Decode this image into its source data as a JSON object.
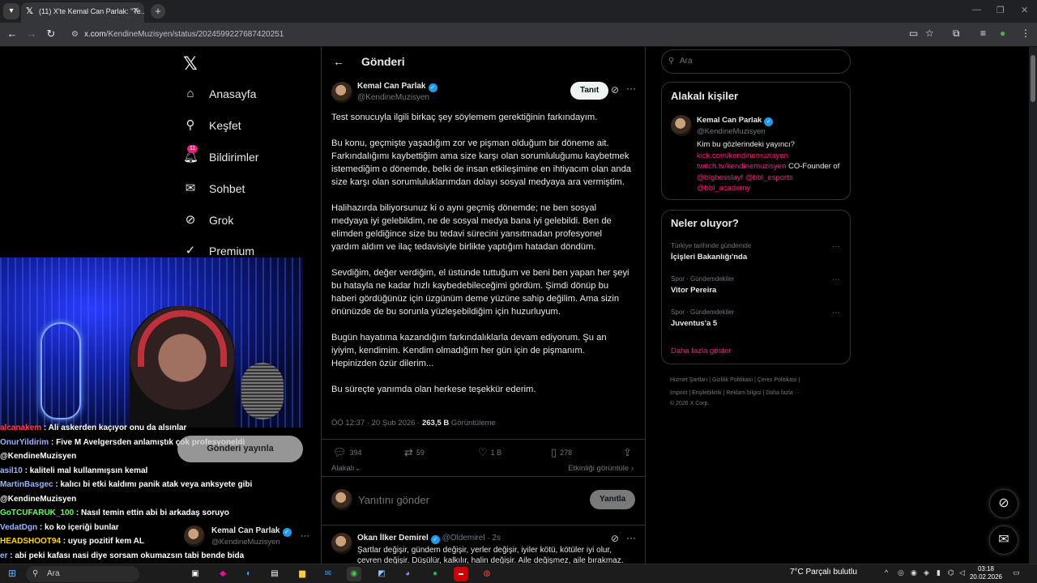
{
  "browser": {
    "tab_title": "(11) X'te Kemal Can Parlak: \"Te...",
    "tab_close": "✕",
    "url_host": "x.com",
    "url_path": "/KendineMuzisyen/status/2024599227687420251"
  },
  "nav": {
    "items": [
      {
        "label": "Anasayfa",
        "icon": "home-icon"
      },
      {
        "label": "Keşfet",
        "icon": "search-icon"
      },
      {
        "label": "Bildirimler",
        "icon": "bell-icon",
        "badge": "11"
      },
      {
        "label": "Sohbet",
        "icon": "mail-icon"
      },
      {
        "label": "Grok",
        "icon": "grok-icon"
      },
      {
        "label": "Premium",
        "icon": "premium-icon"
      }
    ]
  },
  "post": {
    "header_title": "Gönderi",
    "author_name": "Kemal Can Parlak",
    "author_handle": "@KendineMuzisyen",
    "follow_label": "Tanıt",
    "paragraphs": [
      "Test sonucuyla ilgili birkaç şey söylemem gerektiğinin farkındayım.",
      "Bu konu, geçmişte yaşadığım zor ve pişman olduğum bir döneme ait. Farkındalığımı kaybettiğim ama size karşı olan sorumluluğumu kaybetmek istemediğim o dönemde, belki de insan etkileşimine en ihtiyacım olan anda size karşı olan sorumluluklarımdan dolayı sosyal medyaya ara vermiştim.",
      "Halihazırda biliyorsunuz ki o aynı geçmiş dönemde; ne ben sosyal medyaya iyi gelebildim, ne de sosyal medya bana iyi gelebildi. Ben de elimden geldiğince size bu tedavi sürecini yansıtmadan profesyonel yardım aldım ve ilaç tedavisiyle birlikte yaptığım hatadan döndüm.",
      "Sevdiğim, değer verdiğim, el üstünde tuttuğum ve beni ben yapan her şeyi bu hatayla ne kadar hızlı kaybedebileceğimi gördüm. Şimdi dönüp bu haberi gördüğünüz için üzgünüm deme yüzüne sahip değilim. Ama sizin önünüzde de bu sorunla yüzleşebildiğim için huzurluyum.",
      "Bugün hayatıma kazandığım farkındalıklarla devam ediyorum. Şu an iyiyim, kendimim. Kendim olmadığım her gün için de pişmanım. Hepinizden özür dilerim...",
      "Bu süreçte yanımda olan herkese teşekkür ederim."
    ],
    "time": "ÖÖ 12:37 · 20 Şub 2026 · ",
    "views_count": "263,5 B",
    "views_label": " Görüntüleme",
    "replies": "394",
    "reposts": "59",
    "likes": "1 B",
    "bookmarks": "278",
    "relevance_label": "Alakalı",
    "activity_label": "Etkinliği görüntüle",
    "reply_placeholder": "Yanıtını gönder",
    "reply_button": "Yanıtla"
  },
  "reply_tweet": {
    "name": "Okan İlker Demirel",
    "handle": "@Oldemirel · 2s",
    "text": "Şartlar değişir, gündem değişir, yerler değişir, iyiler kötü, kötüler iyi olur, çevren değişir. Düşülür, kalkılır, halin değişir. Aile değişmez, aile bırakmaz."
  },
  "right": {
    "search_placeholder": "Ara",
    "related_title": "Alakalı kişiler",
    "related_name": "Kemal Can Parlak",
    "related_handle": "@KendineMuzisyen",
    "related_bio_1": "Kim bu gözlerindeki yayıncı?",
    "related_link_1": "kick.com/kendinemuzisyen",
    "related_link_2": "twitch.tv/kendinemuzisyen",
    "related_bio_2": " CO-Founder of ",
    "related_link_3": "@blgbosslayf",
    "related_link_4": "@bbl_esports",
    "related_link_5": "@bbl_academy",
    "trends_title": "Neler oluyor?",
    "trends": [
      {
        "category": "Türkiye tarihinde gündemde",
        "name": "İçişleri Bakanlığı'nda"
      },
      {
        "category": "Spor · Gündemdekiler",
        "name": "Vitor Pereira"
      },
      {
        "category": "Spor · Gündemdekiler",
        "name": "Juventus'a 5"
      }
    ],
    "show_more": "Daha fazla göster",
    "footer_line1": "Hizmet Şartları  |  Gizlilik Politikası  |  Çerez Politikası  |",
    "footer_line2": "Imprint  |  Erişilebilirlik  |  Reklam bilgisi  |  Daha fazla ···",
    "footer_line3": "© 2026 X Corp."
  },
  "stream": {
    "publish_button": "Gönderi yayınla",
    "overlay_name": "Kemal Can Parlak",
    "overlay_handle": "@KendineMuzisyen",
    "chat": [
      {
        "user": "alcanakem",
        "color": "#ff4040",
        "msg": " : Ali askerden kaçıyor onu da alsınlar"
      },
      {
        "user": "OnurYildirim",
        "color": "#9bb4ff",
        "msg": " : Five M Avelgersden anlamıştık çok profesyoneldi"
      },
      {
        "user": "",
        "color": "#ffffff",
        "msg": "@KendineMuzisyen"
      },
      {
        "user": "asil10",
        "color": "#9bb4ff",
        "msg": " : kaliteli mal kullanmışsın kemal"
      },
      {
        "user": "MartinBasgec",
        "color": "#9bb4ff",
        "msg": " : kalıcı bi etki kaldımı panik atak veya anksyete gibi"
      },
      {
        "user": "",
        "color": "#ffffff",
        "msg": "@KendineMuzisyen"
      },
      {
        "user": "GoTCUFARUK_100",
        "color": "#5cff5c",
        "msg": " : Nasıl temin ettin abi bi arkadaş soruyo"
      },
      {
        "user": "VedatDgn",
        "color": "#9bb4ff",
        "msg": " : ko ko içeriği bunlar"
      },
      {
        "user": "HEADSHOOT94",
        "color": "#ffd700",
        "msg": " : uyuş pozitif kem AL"
      },
      {
        "user": "er",
        "color": "#9bb4ff",
        "msg": " : abi peki kafası nasi diye sorsam okumazsın tabi bende bida"
      }
    ]
  },
  "taskbar": {
    "search_placeholder": "Ara",
    "weather": "7°C  Parçalı bulutlu",
    "time": "03:18",
    "date": "20.02.2026"
  }
}
